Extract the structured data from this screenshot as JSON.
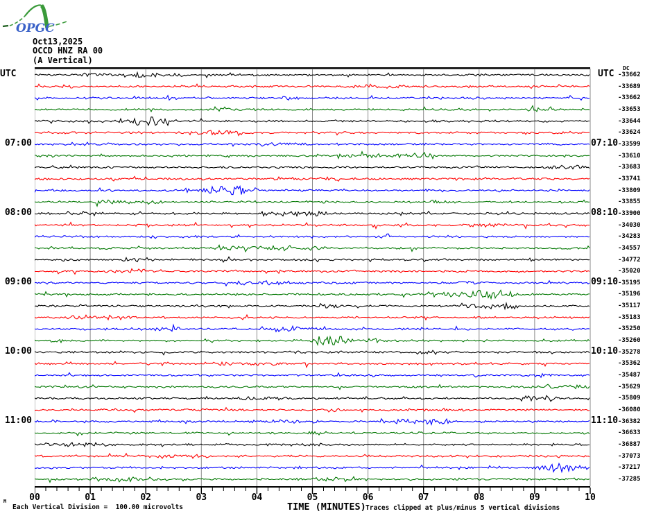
{
  "logo": {
    "text": "OPGC"
  },
  "header": {
    "date": "Oct13,2025",
    "station": "OCCD HNZ RA 00",
    "component": "(A Vertical)"
  },
  "left_axis": {
    "label": "UTC"
  },
  "right_axis": {
    "label": "UTC",
    "dc_label": "DC"
  },
  "x_axis": {
    "title": "TIME (MINUTES)"
  },
  "footer": {
    "scale_note": "Each Vertical Division =  100.00 microvolts",
    "clip_note": "Traces clipped at plus/minus 5 vertical divisions",
    "corner_mark": "M"
  },
  "chart_data": {
    "type": "line",
    "variant": "helicorder-seismogram",
    "title": "OCCD HNZ RA 00 (A Vertical) Oct13,2025",
    "xlabel": "TIME (MINUTES)",
    "x_ticks": [
      "00",
      "01",
      "02",
      "03",
      "04",
      "05",
      "06",
      "07",
      "08",
      "09",
      "10"
    ],
    "x_minor_per_major": 5,
    "rows": 36,
    "minutes_per_row": 10,
    "row_utc_marks": [
      {
        "row": 6,
        "left": "07:00",
        "right": "07:10"
      },
      {
        "row": 12,
        "left": "08:00",
        "right": "08:10"
      },
      {
        "row": 18,
        "left": "09:00",
        "right": "09:10"
      },
      {
        "row": 24,
        "left": "10:00",
        "right": "10:10"
      },
      {
        "row": 30,
        "left": "11:00",
        "right": "11:10"
      }
    ],
    "dc_offsets": [
      -33662,
      -33689,
      -33662,
      -33653,
      -33644,
      -33624,
      -33599,
      -33610,
      -33683,
      -33741,
      -33809,
      -33855,
      -33900,
      -34030,
      -34283,
      -34557,
      -34772,
      -35020,
      -35195,
      -35196,
      -35117,
      -35183,
      -35250,
      -35260,
      -35278,
      -35362,
      -35487,
      -35629,
      -35809,
      -36080,
      -36382,
      -36633,
      -36887,
      -37073,
      -37217,
      -37285
    ],
    "trace_colors": [
      "#000000",
      "#ff0000",
      "#0000ff",
      "#007700"
    ],
    "grid_color": "#8a8a8a",
    "scale_note": "Each Vertical Division =  100.00 microvolts",
    "clip_note": "Traces clipped at plus/minus 5 vertical divisions",
    "amplitude_character": "low-amplitude background noise on all traces, no visible events"
  }
}
